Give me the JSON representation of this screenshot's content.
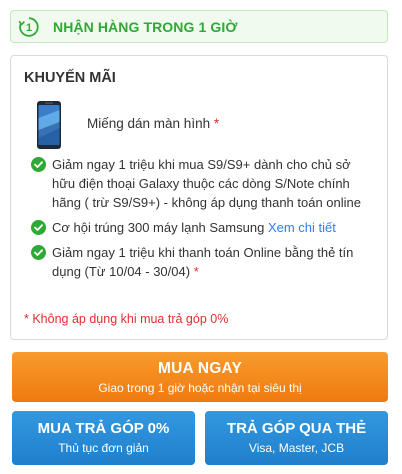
{
  "delivery": {
    "icon": "clock-1-icon",
    "icon_digit": "1",
    "text": "NHẬN HÀNG TRONG 1 GIỜ",
    "color": "#2fa836"
  },
  "promo": {
    "title": "KHUYẾN MÃI",
    "gift": {
      "image": "screen-protector-image",
      "label": "Miếng dán màn hình",
      "star": "*"
    },
    "items": [
      {
        "text": "Giảm ngay 1 triệu khi mua S9/S9+ dành cho chủ sở hữu điện thoại Galaxy thuộc các dòng S/Note chính hãng ( trừ S9/S9+) - không áp dụng thanh toán online"
      },
      {
        "text": "Cơ hội trúng 300 máy lạnh Samsung",
        "link": "Xem chi tiết"
      },
      {
        "text": "Giảm ngay 1 triệu khi thanh toán Online bằng thẻ tín dụng (Từ 10/04 - 30/04)",
        "star": "*"
      }
    ],
    "note": "* Không áp dụng khi mua trả góp 0%"
  },
  "actions": {
    "buy_now": {
      "label": "MUA NGAY",
      "sub": "Giao trong 1 giờ hoặc nhận tại siêu thị",
      "color": "#f78e1d"
    },
    "installment": {
      "label": "MUA TRẢ GÓP 0%",
      "sub": "Thủ tục đơn giản",
      "color": "#288ad6"
    },
    "card_installment": {
      "label": "TRẢ GÓP QUA THẺ",
      "sub": "Visa, Master, JCB",
      "color": "#288ad6"
    }
  },
  "colors": {
    "check": "#2fa836",
    "link": "#2f80ed",
    "warning": "#e02f2f"
  }
}
